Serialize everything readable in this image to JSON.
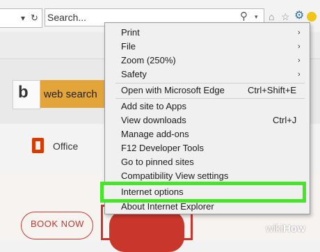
{
  "toolbar": {
    "address_dropdown_glyph": "▾",
    "refresh_glyph": "↻",
    "search_placeholder": "Search...",
    "search_icon_glyph": "⚲",
    "search_dropdown_glyph": "▾",
    "home_glyph": "⌂",
    "favorites_glyph": "☆",
    "tools_glyph": "⚙"
  },
  "page": {
    "bing_logo": "b",
    "web_search_label": "web search",
    "office_label": "Office",
    "book_now_label": "BOOK NOW"
  },
  "menu": {
    "items": [
      {
        "label": "Print",
        "submenu": true,
        "shortcut": ""
      },
      {
        "label": "File",
        "submenu": true,
        "shortcut": ""
      },
      {
        "label": "Zoom (250%)",
        "submenu": true,
        "shortcut": ""
      },
      {
        "label": "Safety",
        "submenu": true,
        "shortcut": ""
      },
      {
        "label": "Open with Microsoft Edge",
        "submenu": false,
        "shortcut": "Ctrl+Shift+E"
      },
      {
        "label": "Add site to Apps",
        "submenu": false,
        "shortcut": ""
      },
      {
        "label": "View downloads",
        "submenu": false,
        "shortcut": "Ctrl+J"
      },
      {
        "label": "Manage add-ons",
        "submenu": false,
        "shortcut": ""
      },
      {
        "label": "F12 Developer Tools",
        "submenu": false,
        "shortcut": ""
      },
      {
        "label": "Go to pinned sites",
        "submenu": false,
        "shortcut": ""
      },
      {
        "label": "Compatibility View settings",
        "submenu": false,
        "shortcut": ""
      },
      {
        "label": "Internet options",
        "submenu": false,
        "shortcut": "",
        "highlighted": true
      },
      {
        "label": "About Internet Explorer",
        "submenu": false,
        "shortcut": ""
      }
    ],
    "submenu_arrow_glyph": "›"
  },
  "colors": {
    "highlight_border": "#47e52a",
    "bing_button": "#e3a43a",
    "accent_red": "#c9372c"
  },
  "watermark": {
    "prefix": "wiki",
    "suffix": "How"
  }
}
